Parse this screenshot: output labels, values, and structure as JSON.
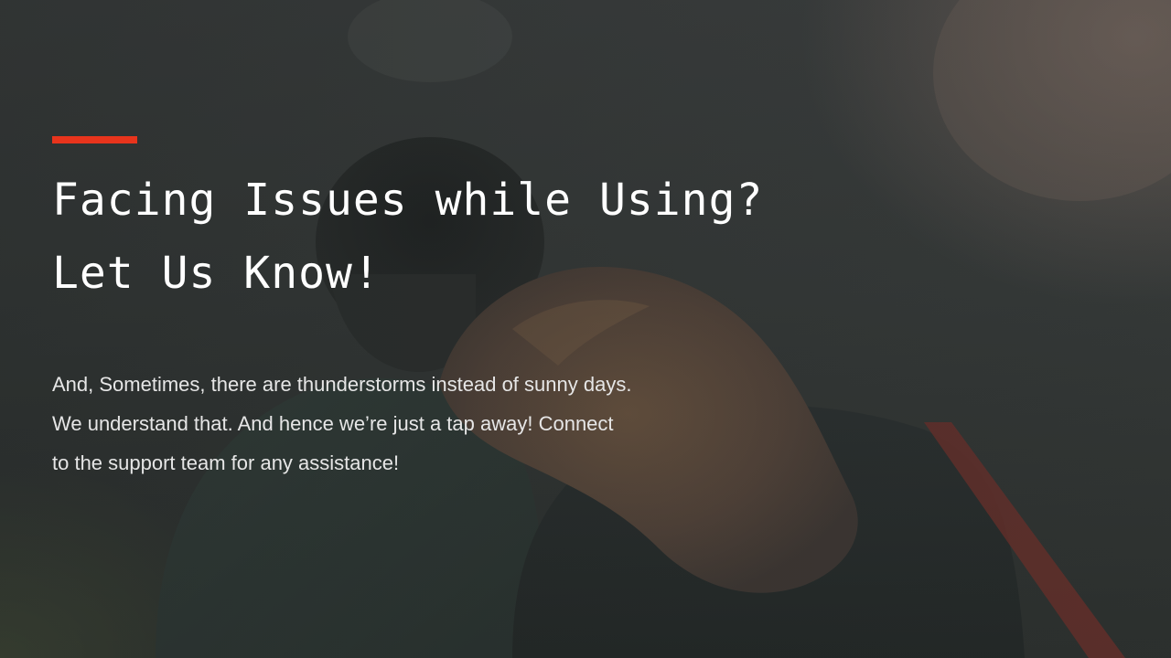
{
  "colors": {
    "accent": "#e8341c",
    "headline": "#ffffff",
    "body": "#e6e6e6"
  },
  "hero": {
    "headline_line1": "Facing Issues while Using?",
    "headline_line2": "Let Us Know!",
    "body_line1": "And, Sometimes, there are thunderstorms instead of sunny days.",
    "body_line2": "We understand that. And hence we’re just a tap away! Connect",
    "body_line3": "to the support team for any assistance!"
  }
}
